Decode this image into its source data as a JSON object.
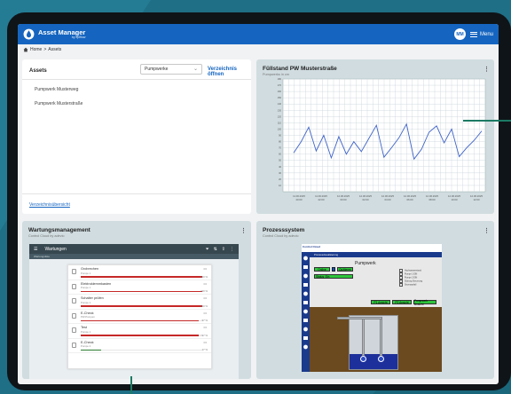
{
  "app": {
    "title": "Asset Manager",
    "subtitle": "by epiflow",
    "user_initials": "MM",
    "menu_label": "Menu"
  },
  "breadcrumb": {
    "home": "Home",
    "separator": ">",
    "current": "Assets"
  },
  "assets_panel": {
    "title": "Assets",
    "filter_value": "Pumpwerke",
    "open_directory": "Verzeichnis öffnen",
    "items": [
      "Pumpwerk Musterweg",
      "Pumpwerk Musterstraße"
    ],
    "overview_link": "Verzeichnisübersicht"
  },
  "chart_panel": {
    "title": "Füllstand PW Musterstraße",
    "subtitle": "Pumpwerks in cm"
  },
  "chart_data": {
    "type": "line",
    "title": "Füllstand PW Musterstraße",
    "ylim": [
      0,
      180
    ],
    "yticks": [
      10,
      20,
      30,
      40,
      50,
      60,
      70,
      80,
      90,
      100,
      110,
      120,
      130,
      140,
      150,
      160,
      170,
      180
    ],
    "x_tick_labels": [
      [
        "11.06.2025",
        "20:00"
      ],
      [
        "11.06.2025",
        "22:00"
      ],
      [
        "12.06.2025",
        "00:00"
      ],
      [
        "12.06.2025",
        "02:00"
      ],
      [
        "12.06.2025",
        "04:00"
      ],
      [
        "12.06.2025",
        "06:00"
      ],
      [
        "12.06.2025",
        "08:00"
      ],
      [
        "12.06.2025",
        "10:00"
      ],
      [
        "12.06.2025",
        "12:00"
      ]
    ],
    "series": [
      {
        "values": [
          62,
          80,
          103,
          65,
          90,
          54,
          88,
          60,
          80,
          64,
          85,
          106,
          55,
          70,
          86,
          108,
          52,
          68,
          95,
          105,
          78,
          100,
          56,
          70,
          82,
          97
        ]
      }
    ],
    "grid": true
  },
  "maintenance_panel": {
    "title": "Wartungsmanagement",
    "subtitle": "Control Cloud by adevio",
    "app_bar_title": "Wartungen",
    "app_bar_sub": "Wartungsliste",
    "tasks": [
      {
        "name": "Grobrechen",
        "detail": "Pumpe 1",
        "progress": 1.0,
        "pct": "100 %",
        "color": "#c62828"
      },
      {
        "name": "Elektroklemmkasten",
        "detail": "Pumpe 1",
        "progress": 1.0,
        "pct": "100 %",
        "color": "#c62828"
      },
      {
        "name": "Schalter prüfen",
        "detail": "Pumpe 1",
        "progress": 1.0,
        "pct": "100 %",
        "color": "#c62828"
      },
      {
        "name": "E-Check",
        "detail": "PW-Pumpen",
        "progress": 0.97,
        "pct": "97 %",
        "color": "#c62828"
      },
      {
        "name": "Test",
        "detail": "Pumpe 1",
        "progress": 0.97,
        "pct": "97 %",
        "color": "#c62828"
      },
      {
        "name": "E-Check",
        "detail": "Pumpe 2",
        "progress": 0.17,
        "pct": "17 %",
        "color": "#2e7d32"
      }
    ],
    "more_label": "•••"
  },
  "process_panel": {
    "title": "Prozesssystem",
    "subtitle": "Control Cloud by adevio",
    "brand": "Control Cloud",
    "tab_label": "Prozessvisualisierung",
    "screen_title": "Pumpwerk",
    "online_label": "Online",
    "quit_label": "Quittieren",
    "status_label": "Status: Ein",
    "bottom_buttons": [
      "P1 Ansicht",
      "P2 Ansicht",
      "Pumpwerk Ansicht"
    ],
    "legend": [
      "Hochwasserstand",
      "Pumpe 1 EIN",
      "Pumpe 2 EIN",
      "Störung Steuerung",
      "Stromausfall"
    ],
    "pump_labels": [
      "1",
      "2"
    ]
  }
}
